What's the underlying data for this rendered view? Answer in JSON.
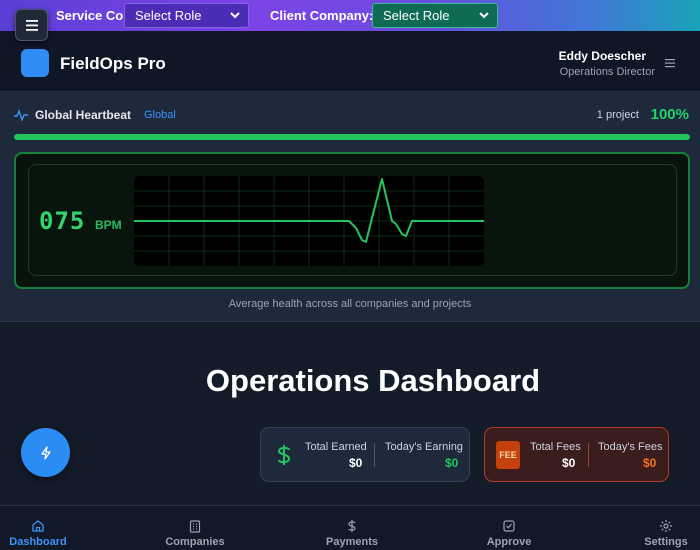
{
  "rolebar": {
    "service_label": "Service Company:",
    "service_value": "Select Role",
    "client_label": "Client Company:",
    "client_value": "Select Role"
  },
  "header": {
    "brand": "FieldOps Pro",
    "user_name": "Eddy Doescher",
    "user_role": "Operations Director"
  },
  "heartbeat": {
    "title": "Global Heartbeat",
    "scope": "Global",
    "project_count": "1 project",
    "percent_label": "100%",
    "progress": 1.0,
    "bpm": "075",
    "bpm_unit": "BPM",
    "caption": "Average health across all companies and projects"
  },
  "dashboard": {
    "title": "Operations Dashboard",
    "earnings": {
      "total_label": "Total Earned",
      "total_value": "$0",
      "today_label": "Today's Earning",
      "today_value": "$0"
    },
    "fees": {
      "badge": "FEE",
      "total_label": "Total Fees",
      "total_value": "$0",
      "today_label": "Today's Fees",
      "today_value": "$0"
    }
  },
  "nav": {
    "items": [
      {
        "label": "Dashboard",
        "icon": "home-icon",
        "active": true
      },
      {
        "label": "Companies",
        "icon": "building-icon",
        "active": false
      },
      {
        "label": "Payments",
        "icon": "dollar-icon",
        "active": false
      },
      {
        "label": "Approve",
        "icon": "check-square-icon",
        "active": false
      },
      {
        "label": "Settings",
        "icon": "gear-icon",
        "active": false
      }
    ]
  },
  "colors": {
    "accent": "#2b8cf4",
    "health_green": "#22c55e",
    "fee_orange": "#f97316"
  }
}
